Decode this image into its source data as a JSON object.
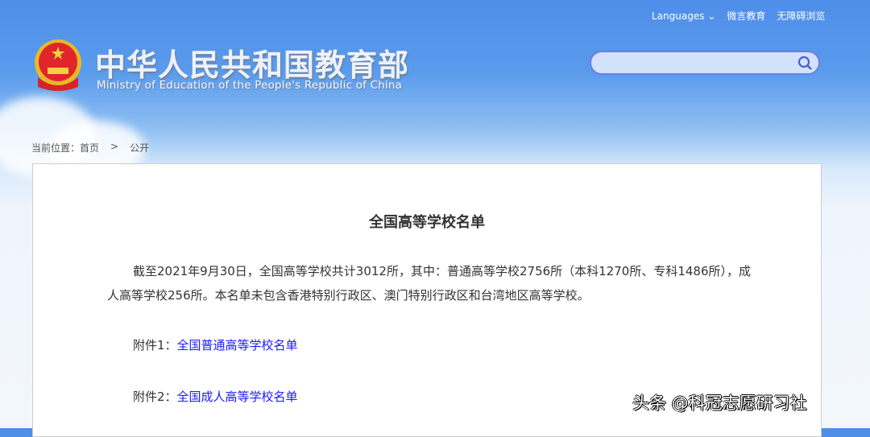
{
  "header": {
    "title_cn": "中华人民共和国教育部",
    "title_en": "Ministry of Education of the People's Republic of China",
    "nav": {
      "languages": "Languages",
      "weiyan": "微言教育",
      "accessibility": "无障碍浏览"
    },
    "search": {
      "placeholder": ""
    }
  },
  "breadcrumb": {
    "label": "当前位置：",
    "home": "首页",
    "separator": ">",
    "current": "公开"
  },
  "article": {
    "title": "全国高等学校名单",
    "paragraph": "截至2021年9月30日，全国高等学校共计3012所，其中：普通高等学校2756所（本科1270所、专科1486所），成人高等学校256所。本名单未包含香港特别行政区、澳门特别行政区和台湾地区高等学校。",
    "attachments": [
      {
        "label": "附件1：",
        "link": "全国普通高等学校名单"
      },
      {
        "label": "附件2：",
        "link": "全国成人高等学校名单"
      }
    ]
  },
  "watermark": "头条 @科冠志愿研习社"
}
